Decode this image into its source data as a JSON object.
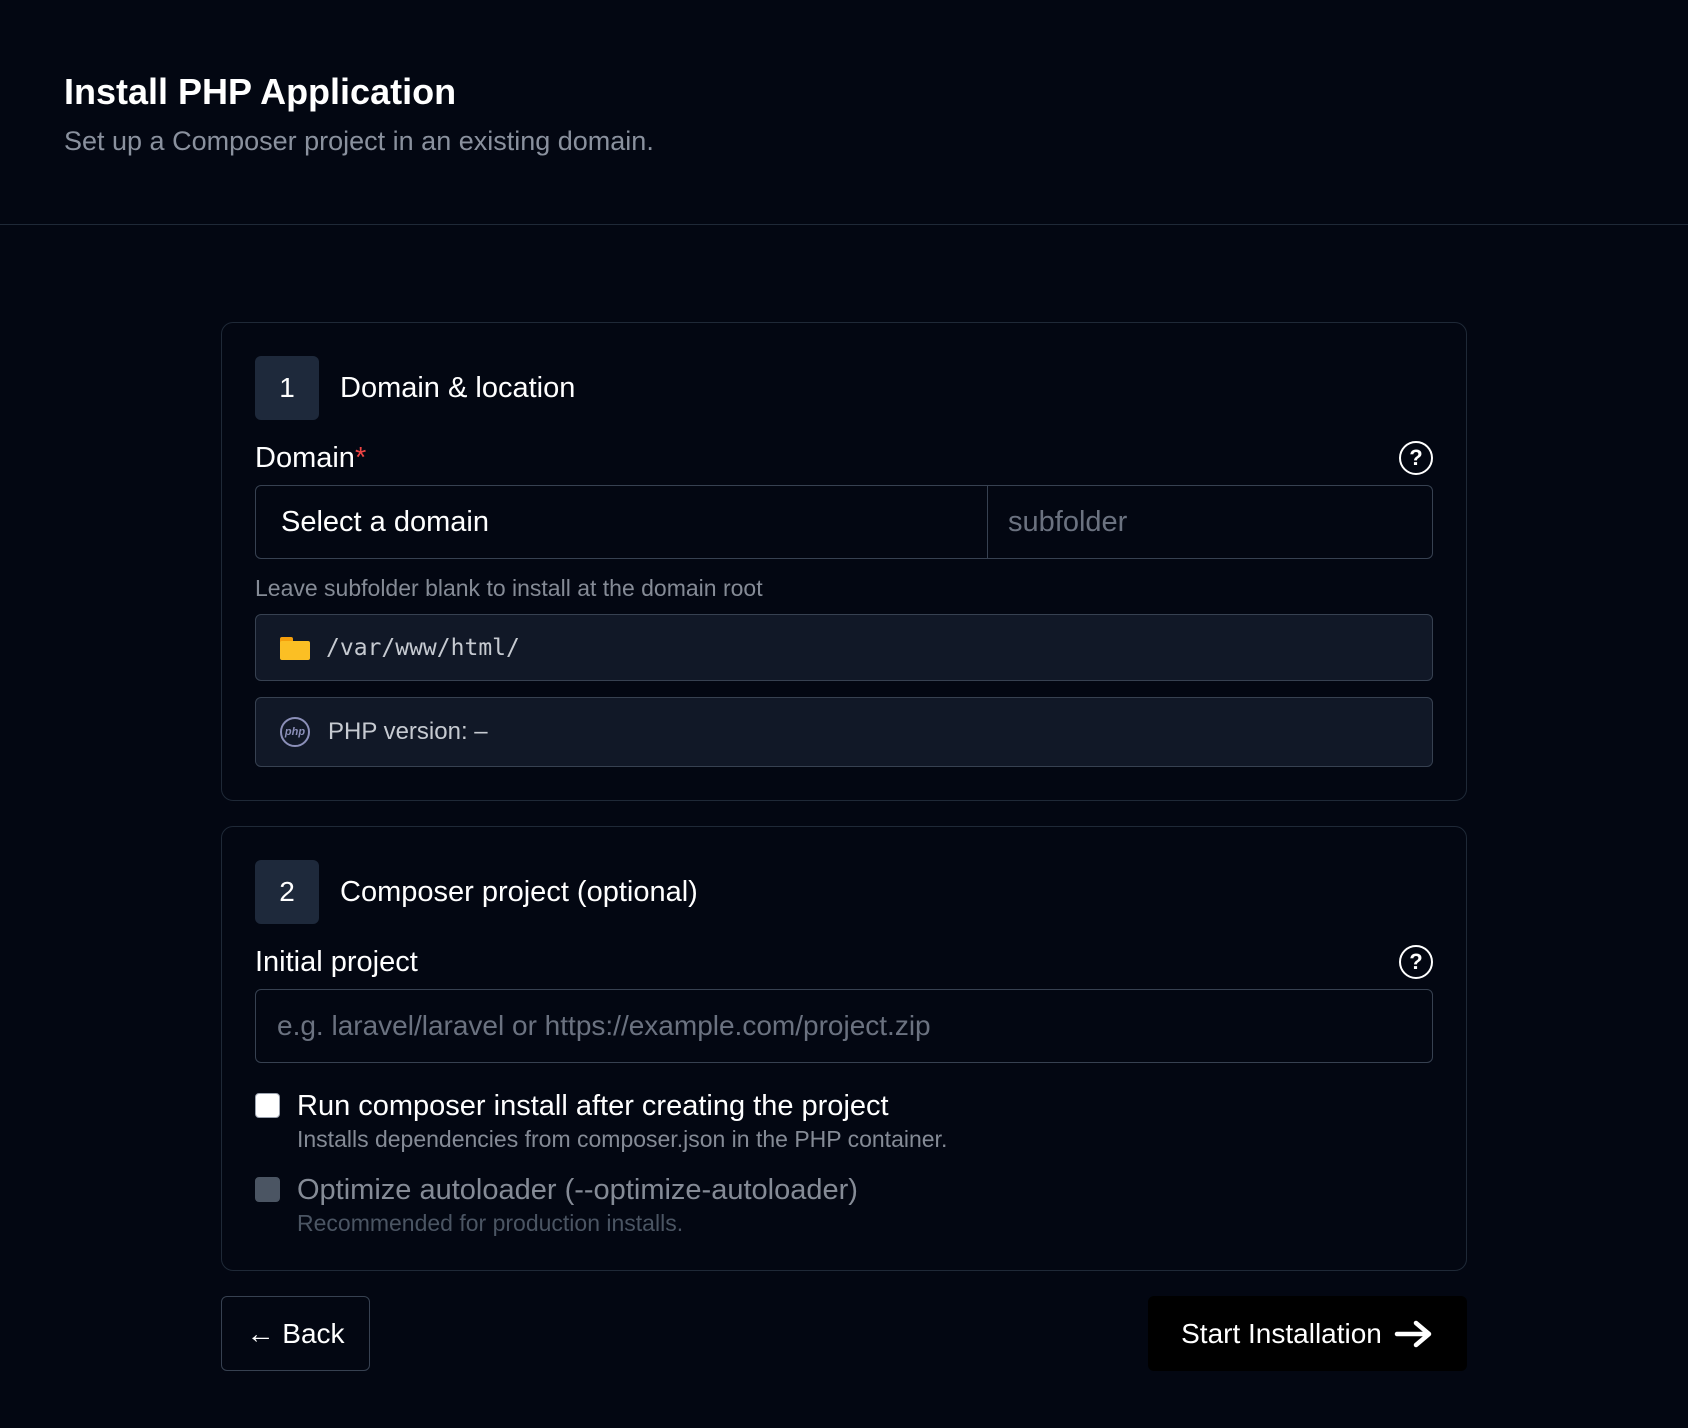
{
  "header": {
    "title": "Install PHP Application",
    "subtitle": "Set up a Composer project in an existing domain."
  },
  "step1": {
    "number": "1",
    "title": "Domain & location",
    "domain_label": "Domain",
    "required_mark": "*",
    "help_icon": "question-circle-icon",
    "domain_select_value": "Select a domain",
    "subfolder_placeholder": "subfolder",
    "subfolder_hint": "Leave subfolder blank to install at the domain root",
    "path": "/var/www/html/",
    "path_icon": "folder-icon",
    "php_icon": "php-icon",
    "php_version_text": "PHP version: –"
  },
  "step2": {
    "number": "2",
    "title": "Composer project (optional)",
    "project_label": "Initial project",
    "help_icon": "question-circle-icon",
    "project_placeholder": "e.g. laravel/laravel or https://example.com/project.zip",
    "options": [
      {
        "label": "Run composer install after creating the project",
        "description": "Installs dependencies from composer.json in the PHP container.",
        "checked": false,
        "disabled": false
      },
      {
        "label": "Optimize autoloader (--optimize-autoloader)",
        "description": "Recommended for production installs.",
        "checked": false,
        "disabled": true
      }
    ]
  },
  "actions": {
    "back_label": "← Back",
    "start_label": "Start Installation",
    "start_icon": "arrow-right-icon"
  },
  "colors": {
    "background": "#030712",
    "border": "#1f2937",
    "required": "#ef4444",
    "folder": "#fbbf24"
  }
}
